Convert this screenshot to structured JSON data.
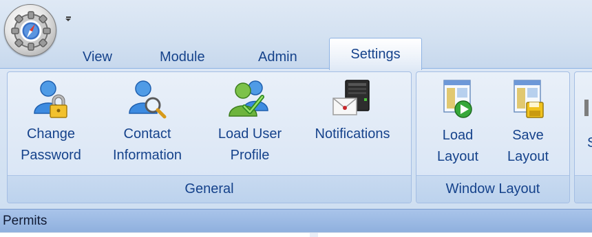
{
  "quick_access": {
    "customize_icon": "dropdown-arrow-icon"
  },
  "app_menu": {
    "icon": "gear-compass-orb-icon"
  },
  "tabs": [
    {
      "label": "View"
    },
    {
      "label": "Module"
    },
    {
      "label": "Admin"
    },
    {
      "label": "Settings",
      "active": true
    }
  ],
  "groups": {
    "general": {
      "label": "General",
      "buttons": [
        {
          "line1": "Change",
          "line2": "Password",
          "icon": "user-lock-icon"
        },
        {
          "line1": "Contact",
          "line2": "Information",
          "icon": "user-search-icon"
        },
        {
          "line1": "Load User",
          "line2": "Profile",
          "icon": "users-check-icon"
        },
        {
          "line1": "Notifications",
          "line2": "",
          "icon": "envelope-server-icon"
        }
      ]
    },
    "window_layout": {
      "label": "Window Layout",
      "buttons": [
        {
          "line1": "Load",
          "line2": "Layout",
          "icon": "window-play-icon"
        },
        {
          "line1": "Save",
          "line2": "Layout",
          "icon": "window-save-icon"
        }
      ]
    },
    "third": {
      "partial_label": "S"
    }
  },
  "panel": {
    "title": "Permits"
  },
  "colors": {
    "text": "#15428b",
    "ribbon": "#dfe9f6",
    "panel_bar": "#9dbbe4"
  }
}
